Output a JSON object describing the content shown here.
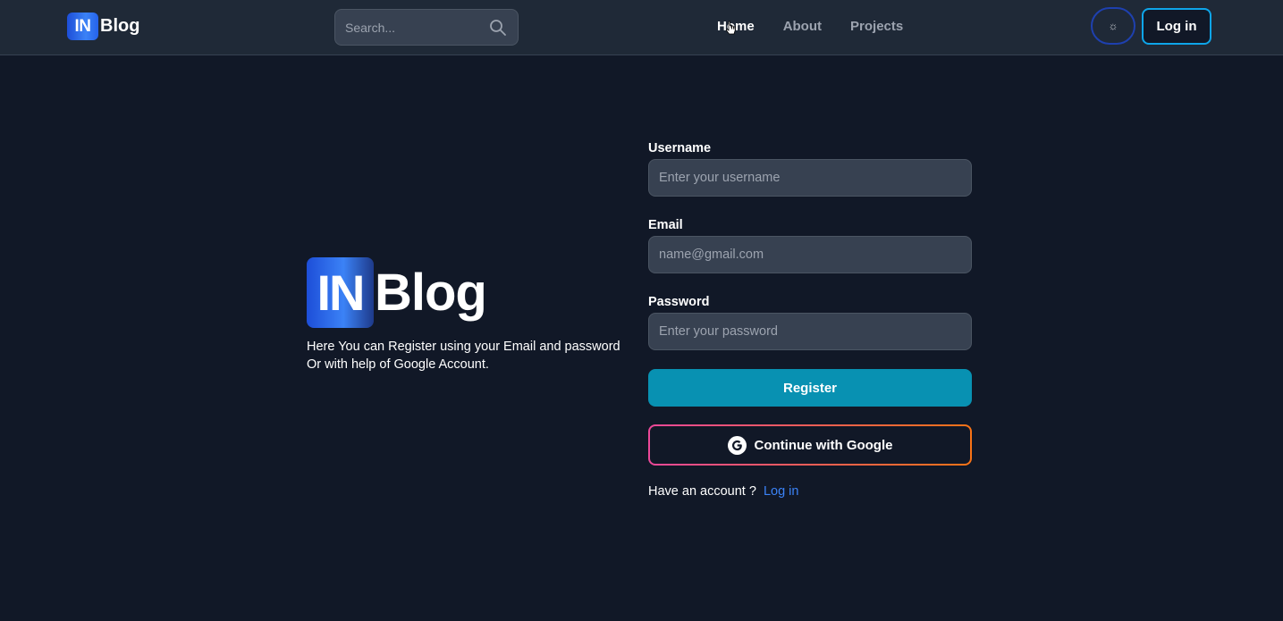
{
  "header": {
    "brand_badge": "IN",
    "brand_word": "Blog",
    "search_placeholder": "Search...",
    "nav": [
      {
        "label": "Home",
        "active": true
      },
      {
        "label": "About",
        "active": false
      },
      {
        "label": "Projects",
        "active": false
      }
    ],
    "theme_toggle_icon": "sun-icon",
    "theme_toggle_glyph": "☼",
    "login_label": "Log in"
  },
  "hero": {
    "badge": "IN",
    "word": "Blog",
    "description_line1": "Here You can Register using your Email and password",
    "description_line2": "Or with help of Google Account."
  },
  "form": {
    "username_label": "Username",
    "username_placeholder": "Enter your username",
    "email_label": "Email",
    "email_placeholder": "name@gmail.com",
    "password_label": "Password",
    "password_placeholder": "Enter your password",
    "register_label": "Register",
    "google_label": "Continue with Google",
    "have_account_text": "Have an account ?",
    "login_link": "Log in"
  },
  "colors": {
    "background": "#111827",
    "header": "#1f2937",
    "accent": "#0891b2",
    "link": "#3b82f6",
    "google_border_start": "#ec4899",
    "google_border_end": "#f97316"
  }
}
